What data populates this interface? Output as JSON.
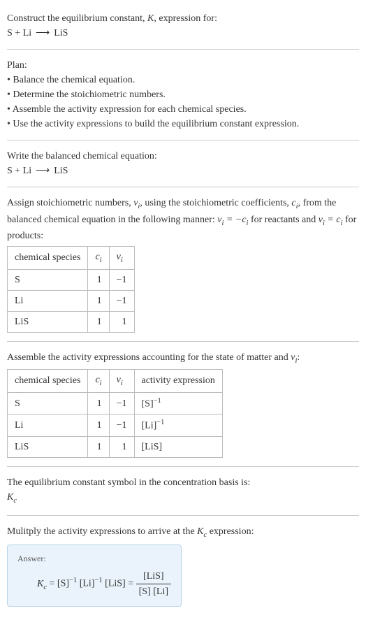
{
  "intro": {
    "line1_a": "Construct the equilibrium constant, ",
    "line1_b": ", expression for:",
    "reaction_lhs1": "S",
    "plus": " + ",
    "reaction_lhs2": "Li",
    "arrow": "⟶",
    "reaction_rhs": "LiS"
  },
  "plan": {
    "heading": "Plan:",
    "b1": "• Balance the chemical equation.",
    "b2": "• Determine the stoichiometric numbers.",
    "b3": "• Assemble the activity expression for each chemical species.",
    "b4": "• Use the activity expressions to build the equilibrium constant expression."
  },
  "balanced": {
    "heading": "Write the balanced chemical equation:",
    "lhs1": "S",
    "plus": " + ",
    "lhs2": "Li",
    "arrow": "⟶",
    "rhs": "LiS"
  },
  "stoich": {
    "text_a": "Assign stoichiometric numbers, ",
    "nu_i": "ν",
    "sub_i": "i",
    "text_b": ", using the stoichiometric coefficients, ",
    "c_i": "c",
    "text_c": ", from the balanced chemical equation in the following manner: ",
    "rel1a": "ν",
    "rel1b": " = −",
    "rel1c": "c",
    "text_d": " for reactants and ",
    "rel2a": "ν",
    "rel2b": " = ",
    "rel2c": "c",
    "text_e": " for products:",
    "th1": "chemical species",
    "th2": "c",
    "th2_sub": "i",
    "th3": "ν",
    "th3_sub": "i",
    "r1c1": "S",
    "r1c2": "1",
    "r1c3": "−1",
    "r2c1": "Li",
    "r2c2": "1",
    "r2c3": "−1",
    "r3c1": "LiS",
    "r3c2": "1",
    "r3c3": "1"
  },
  "activity": {
    "text_a": "Assemble the activity expressions accounting for the state of matter and ",
    "nu": "ν",
    "sub_i": "i",
    "text_b": ":",
    "th1": "chemical species",
    "th2": "c",
    "th2_sub": "i",
    "th3": "ν",
    "th3_sub": "i",
    "th4": "activity expression",
    "r1c1": "S",
    "r1c2": "1",
    "r1c3": "−1",
    "r1c4a": "[S]",
    "r1c4b": "−1",
    "r2c1": "Li",
    "r2c2": "1",
    "r2c3": "−1",
    "r2c4a": "[Li]",
    "r2c4b": "−1",
    "r3c1": "LiS",
    "r3c2": "1",
    "r3c3": "1",
    "r3c4a": "[LiS]"
  },
  "symbol": {
    "text": "The equilibrium constant symbol in the concentration basis is:",
    "K": "K",
    "c": "c"
  },
  "multiply": {
    "text_a": "Mulitply the activity expressions to arrive at the ",
    "K": "K",
    "c": "c",
    "text_b": " expression:"
  },
  "answer": {
    "label": "Answer:",
    "K": "K",
    "c": "c",
    "eqs": " = ",
    "t1a": "[S]",
    "t1b": "−1",
    "t2a": "[Li]",
    "t2b": "−1",
    "t3a": "[LiS]",
    "eq2": " = ",
    "num": "[LiS]",
    "den": "[S] [Li]"
  }
}
